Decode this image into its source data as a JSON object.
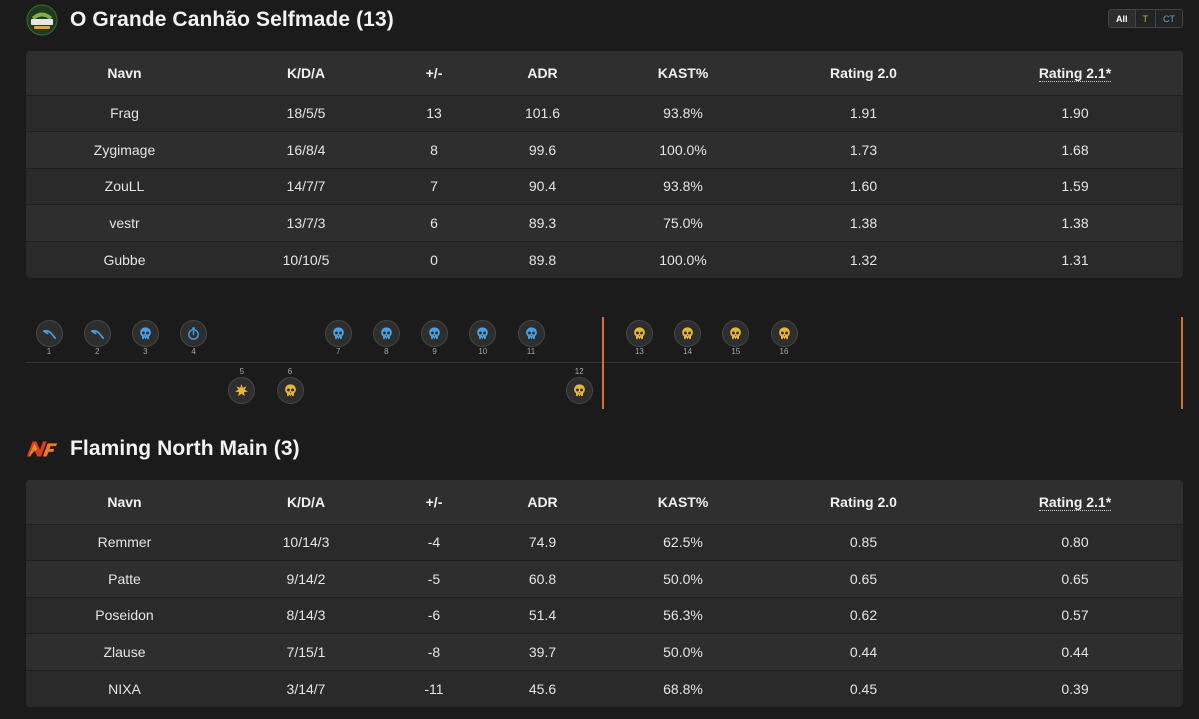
{
  "filters": {
    "all": "All",
    "t": "T",
    "ct": "CT"
  },
  "team1": {
    "name": "O Grande Canhão Selfmade (13)",
    "columns": [
      "Navn",
      "K/D/A",
      "+/-",
      "ADR",
      "KAST%",
      "Rating 2.0",
      "Rating 2.1*"
    ],
    "rows": [
      [
        "Frag",
        "18/5/5",
        "13",
        "101.6",
        "93.8%",
        "1.91",
        "1.90"
      ],
      [
        "Zygimage",
        "16/8/4",
        "8",
        "99.6",
        "100.0%",
        "1.73",
        "1.68"
      ],
      [
        "ZouLL",
        "14/7/7",
        "7",
        "90.4",
        "93.8%",
        "1.60",
        "1.59"
      ],
      [
        "vestr",
        "13/7/3",
        "6",
        "89.3",
        "75.0%",
        "1.38",
        "1.38"
      ],
      [
        "Gubbe",
        "10/10/5",
        "0",
        "89.8",
        "100.0%",
        "1.32",
        "1.31"
      ]
    ]
  },
  "team2": {
    "name": "Flaming North Main (3)",
    "columns": [
      "Navn",
      "K/D/A",
      "+/-",
      "ADR",
      "KAST%",
      "Rating 2.0",
      "Rating 2.1*"
    ],
    "rows": [
      [
        "Remmer",
        "10/14/3",
        "-4",
        "74.9",
        "62.5%",
        "0.85",
        "0.80"
      ],
      [
        "Patte",
        "9/14/2",
        "-5",
        "60.8",
        "50.0%",
        "0.65",
        "0.65"
      ],
      [
        "Poseidon",
        "8/14/3",
        "-6",
        "51.4",
        "56.3%",
        "0.62",
        "0.57"
      ],
      [
        "Zlause",
        "7/15/1",
        "-8",
        "39.7",
        "50.0%",
        "0.44",
        "0.44"
      ],
      [
        "NIXA",
        "3/14/7",
        "-11",
        "45.6",
        "68.8%",
        "0.45",
        "0.39"
      ]
    ]
  },
  "colors": {
    "ct": "#4a9ee0",
    "t": "#e8b63a",
    "half_marker": "#d9702a"
  },
  "rounds": [
    {
      "n": "1",
      "winner": "top",
      "icon": "defuse-icon",
      "side": "ct"
    },
    {
      "n": "2",
      "winner": "top",
      "icon": "defuse-icon",
      "side": "ct"
    },
    {
      "n": "3",
      "winner": "top",
      "icon": "skull-icon",
      "side": "ct"
    },
    {
      "n": "4",
      "winner": "top",
      "icon": "stopwatch-icon",
      "side": "ct"
    },
    {
      "n": "5",
      "winner": "bottom",
      "icon": "explosion-icon",
      "side": "t"
    },
    {
      "n": "6",
      "winner": "bottom",
      "icon": "skull-icon",
      "side": "t"
    },
    {
      "n": "7",
      "winner": "top",
      "icon": "skull-icon",
      "side": "ct"
    },
    {
      "n": "8",
      "winner": "top",
      "icon": "skull-icon",
      "side": "ct"
    },
    {
      "n": "9",
      "winner": "top",
      "icon": "skull-icon",
      "side": "ct"
    },
    {
      "n": "10",
      "winner": "top",
      "icon": "skull-icon",
      "side": "ct"
    },
    {
      "n": "11",
      "winner": "top",
      "icon": "skull-icon",
      "side": "ct"
    },
    {
      "n": "12",
      "winner": "bottom",
      "icon": "skull-icon",
      "side": "t"
    },
    {
      "n": "13",
      "winner": "top",
      "icon": "skull-icon",
      "side": "t"
    },
    {
      "n": "14",
      "winner": "top",
      "icon": "skull-icon",
      "side": "t"
    },
    {
      "n": "15",
      "winner": "top",
      "icon": "skull-icon",
      "side": "t"
    },
    {
      "n": "16",
      "winner": "top",
      "icon": "skull-icon",
      "side": "t"
    }
  ]
}
